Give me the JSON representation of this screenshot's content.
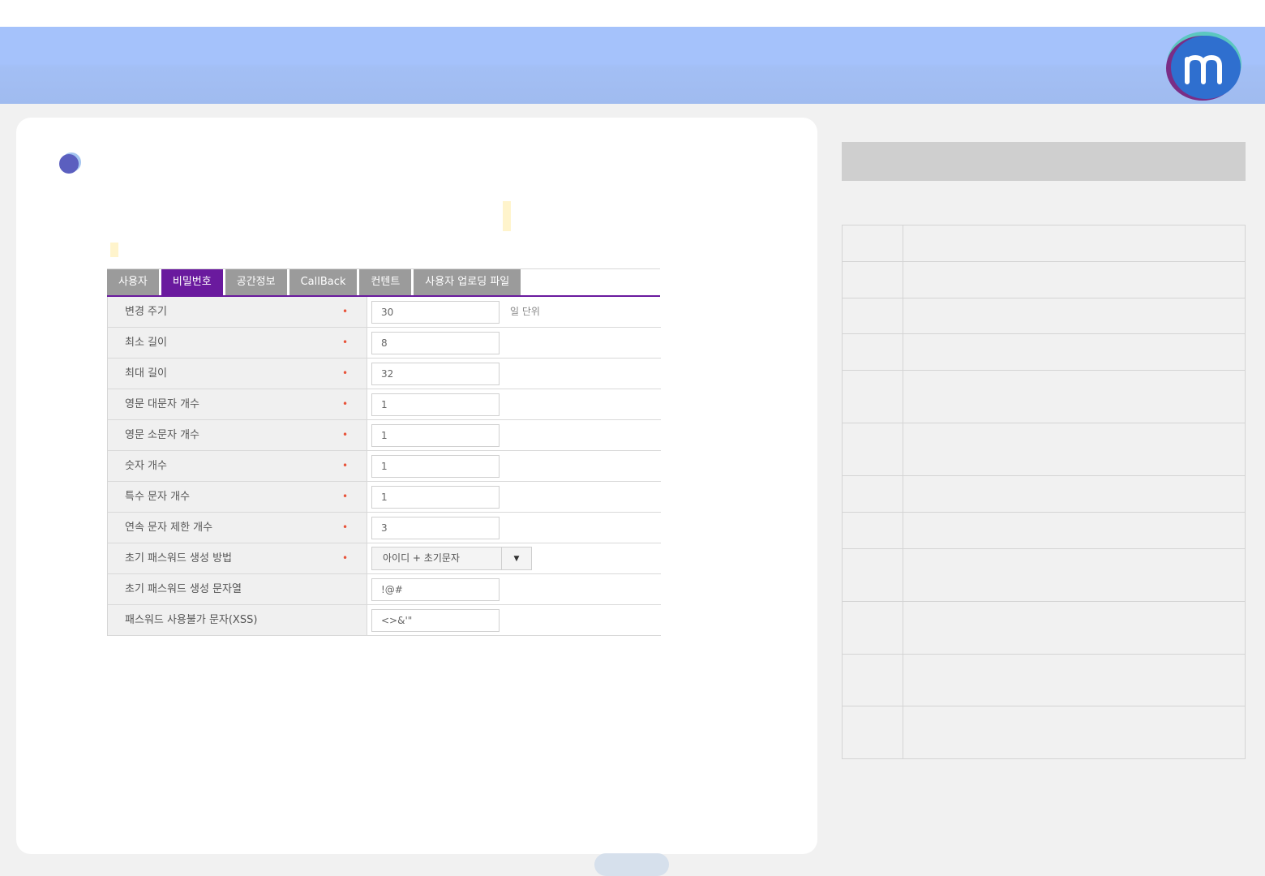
{
  "tabs": [
    {
      "label": "사용자",
      "active": false
    },
    {
      "label": "비밀번호",
      "active": true
    },
    {
      "label": "공간정보",
      "active": false
    },
    {
      "label": "CallBack",
      "active": false
    },
    {
      "label": "컨텐트",
      "active": false
    },
    {
      "label": "사용자 업로딩 파일",
      "active": false
    }
  ],
  "form": {
    "required_mark": "•",
    "change_period": {
      "label": "변경 주기",
      "value": "30",
      "unit": "일 단위"
    },
    "min_length": {
      "label": "최소 길이",
      "value": "8"
    },
    "max_length": {
      "label": "최대 길이",
      "value": "32"
    },
    "upper_count": {
      "label": "영문 대문자 개수",
      "value": "1"
    },
    "lower_count": {
      "label": "영문 소문자 개수",
      "value": "1"
    },
    "digit_count": {
      "label": "숫자 개수",
      "value": "1"
    },
    "special_count": {
      "label": "특수 문자 개수",
      "value": "1"
    },
    "consecutive_limit": {
      "label": "연속 문자 제한 개수",
      "value": "3"
    },
    "init_method": {
      "label": "초기 패스워드 생성 방법",
      "selected": "아이디 + 초기문자"
    },
    "init_string": {
      "label": "초기 패스워드 생성 문자열",
      "value": "!@#"
    },
    "disallowed_chars": {
      "label": "패스워드 사용불가 문자(XSS)",
      "value": "<>&'\""
    }
  },
  "colors": {
    "banner": "#a5c2fb",
    "tab_active": "#6a1a9e",
    "tab_inactive": "#9b9b9b",
    "required": "#e8533a"
  },
  "icons": {
    "logo": "m-logo",
    "section": "section-bullet-icon",
    "dropdown": "caret-down-icon"
  }
}
